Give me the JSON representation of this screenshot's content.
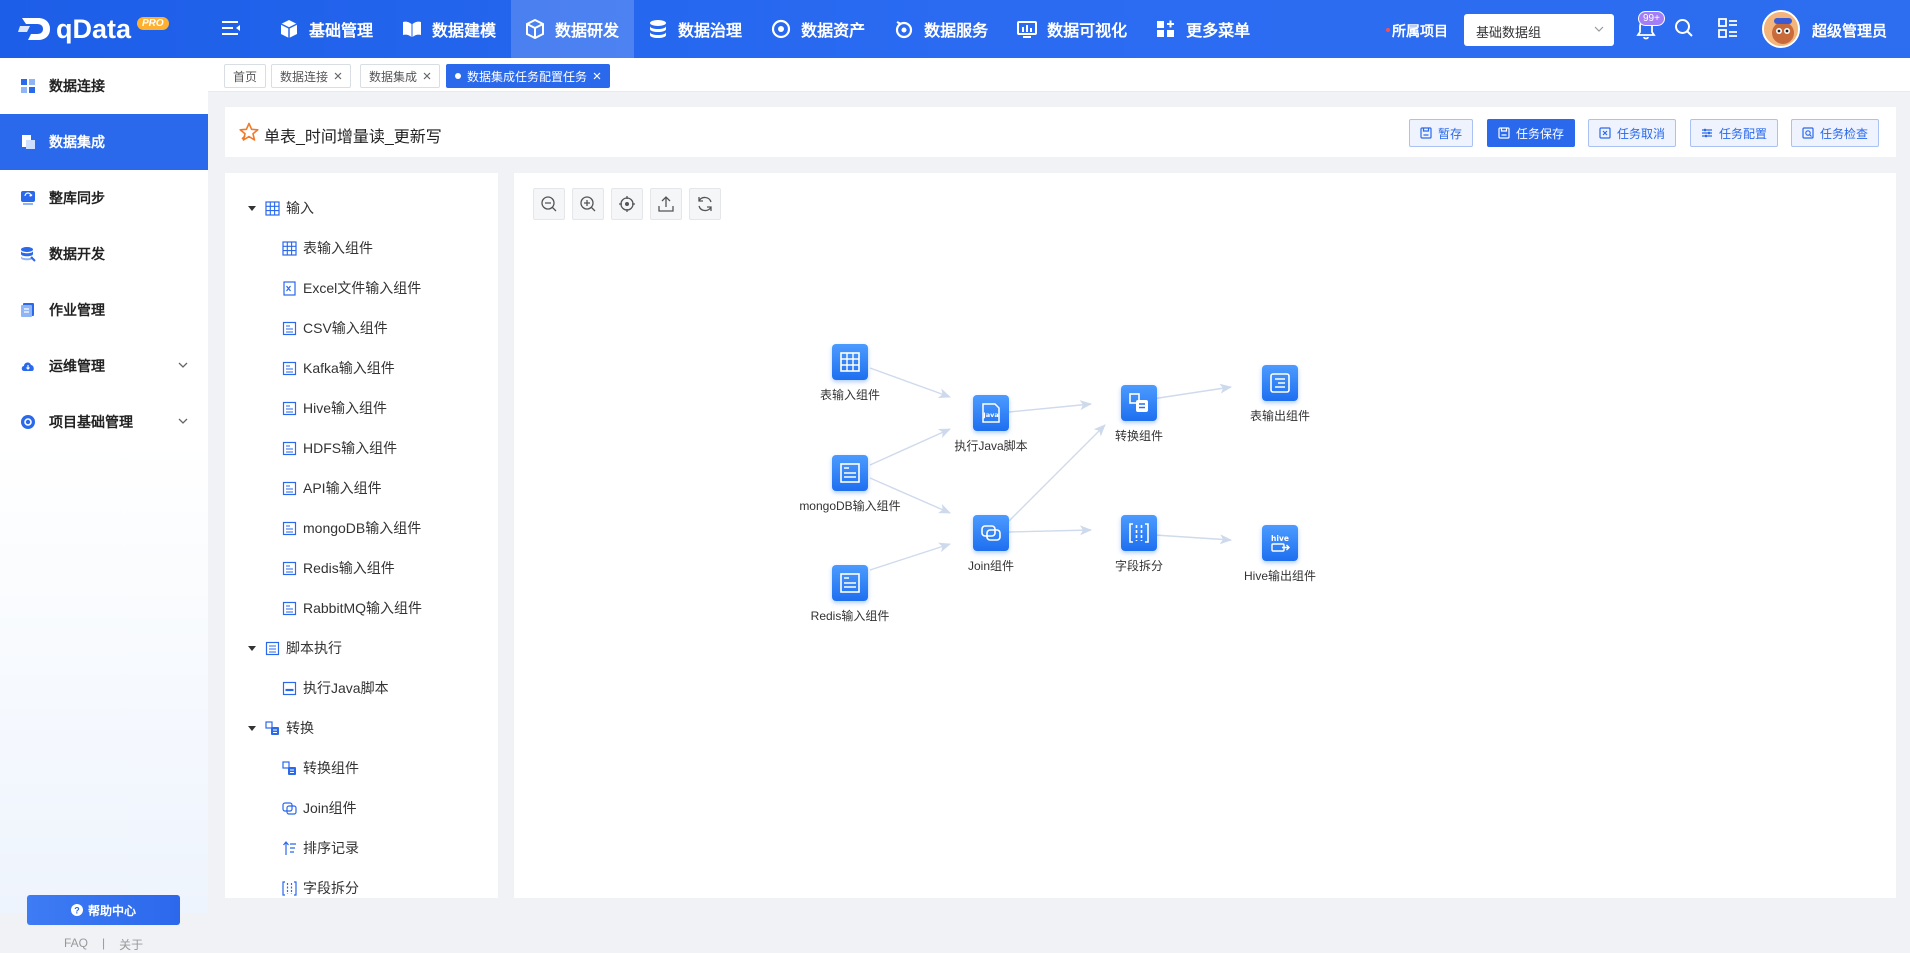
{
  "app": {
    "logo_text": "qData",
    "logo_badge": "PRO"
  },
  "top_nav": [
    {
      "label": "基础管理",
      "icon": "cube-icon"
    },
    {
      "label": "数据建模",
      "icon": "book-icon"
    },
    {
      "label": "数据研发",
      "icon": "box-icon",
      "active": true
    },
    {
      "label": "数据治理",
      "icon": "database-icon"
    },
    {
      "label": "数据资产",
      "icon": "asset-icon"
    },
    {
      "label": "数据服务",
      "icon": "service-icon"
    },
    {
      "label": "数据可视化",
      "icon": "chart-icon"
    },
    {
      "label": "更多菜单",
      "icon": "more-menu-icon"
    }
  ],
  "header": {
    "project_label": "所属项目",
    "project_value": "基础数据组",
    "notification_badge": "99+",
    "user_name": "超级管理员"
  },
  "sidebar": {
    "items": [
      {
        "label": "数据连接"
      },
      {
        "label": "数据集成",
        "active": true
      },
      {
        "label": "整库同步"
      },
      {
        "label": "数据开发"
      },
      {
        "label": "作业管理"
      },
      {
        "label": "运维管理",
        "expandable": true
      },
      {
        "label": "项目基础管理",
        "expandable": true
      }
    ],
    "help_label": "帮助中心",
    "faq_label": "FAQ",
    "separator": "|",
    "about_label": "关于"
  },
  "tabs": [
    {
      "label": "首页"
    },
    {
      "label": "数据连接",
      "closable": true
    },
    {
      "label": "数据集成",
      "closable": true
    },
    {
      "label": "数据集成任务配置任务",
      "closable": true,
      "active": true
    }
  ],
  "page": {
    "title": "单表_时间增量读_更新写",
    "buttons": {
      "temp_save": "暂存",
      "save": "任务保存",
      "cancel": "任务取消",
      "config": "任务配置",
      "check": "任务检查"
    }
  },
  "tree": {
    "groups": [
      {
        "label": "输入",
        "children": [
          "表输入组件",
          "Excel文件输入组件",
          "CSV输入组件",
          "Kafka输入组件",
          "Hive输入组件",
          "HDFS输入组件",
          "API输入组件",
          "mongoDB输入组件",
          "Redis输入组件",
          "RabbitMQ输入组件"
        ]
      },
      {
        "label": "脚本执行",
        "children": [
          "执行Java脚本"
        ]
      },
      {
        "label": "转换",
        "children": [
          "转换组件",
          "Join组件",
          "排序记录",
          "字段拆分"
        ]
      }
    ]
  },
  "canvas": {
    "tools": [
      "zoom-out",
      "zoom-in",
      "locate",
      "export",
      "refresh"
    ],
    "nodes": {
      "table_input": "表输入组件",
      "mongo_input": "mongoDB输入组件",
      "redis_input": "Redis输入组件",
      "java_script": "执行Java脚本",
      "join": "Join组件",
      "transform": "转换组件",
      "field_split": "字段拆分",
      "table_output": "表输出组件",
      "hive_output": "Hive输出组件"
    },
    "java_glyph": "Java",
    "hive_glyph": "hive"
  }
}
